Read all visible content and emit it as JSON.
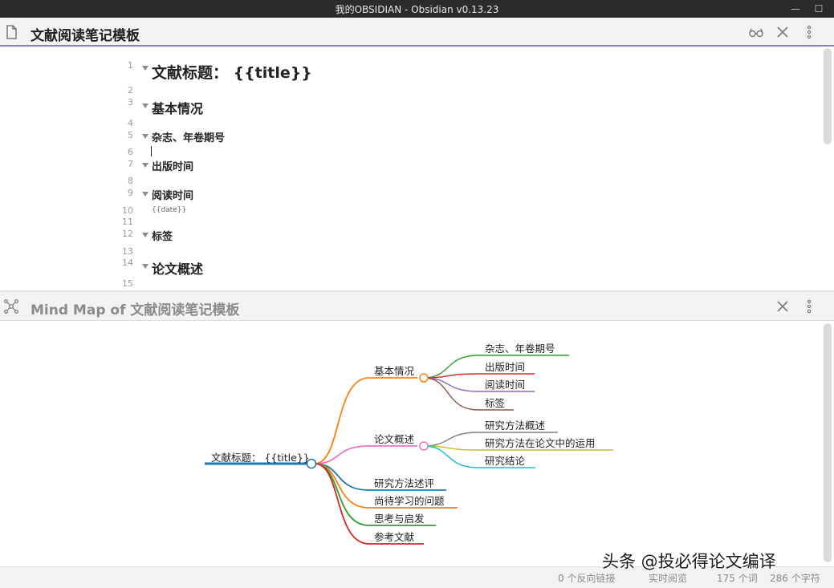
{
  "window": {
    "title": "我的OBSIDIAN - Obsidian v0.13.23",
    "minimize": "—",
    "maximize": "☐"
  },
  "editor": {
    "title": "文献阅读笔记模板",
    "icons": [
      "file-icon",
      "reading-view-icon",
      "close-icon",
      "more-options-icon"
    ],
    "lines": [
      {
        "n": "1",
        "text": "文献标题： {{title}}",
        "style": "h1",
        "fold": true
      },
      {
        "n": "2",
        "text": "",
        "style": "",
        "fold": false
      },
      {
        "n": "3",
        "text": "基本情况",
        "style": "h2",
        "fold": true
      },
      {
        "n": "4",
        "text": "",
        "style": "",
        "fold": false
      },
      {
        "n": "5",
        "text": "杂志、年卷期号",
        "style": "h3",
        "fold": true
      },
      {
        "n": "6",
        "text": "",
        "style": "",
        "fold": false
      },
      {
        "n": "7",
        "text": "出版时间",
        "style": "h3",
        "fold": true
      },
      {
        "n": "8",
        "text": "",
        "style": "",
        "fold": false
      },
      {
        "n": "9",
        "text": "阅读时间",
        "style": "h3",
        "fold": true
      },
      {
        "n": "10",
        "text": "{{date}}",
        "style": "small",
        "fold": false
      },
      {
        "n": "11",
        "text": "",
        "style": "",
        "fold": false
      },
      {
        "n": "12",
        "text": "标签",
        "style": "h3",
        "fold": true
      },
      {
        "n": "13",
        "text": "",
        "style": "",
        "fold": false
      },
      {
        "n": "14",
        "text": "论文概述",
        "style": "h2",
        "fold": true
      },
      {
        "n": "15",
        "text": "",
        "style": "",
        "fold": false
      }
    ]
  },
  "mindmap": {
    "title": "Mind Map of 文献阅读笔记模板",
    "root": {
      "label": "文献标题： {{title}}",
      "color": "#1f77b4"
    },
    "branches": [
      {
        "label": "基本情况",
        "color": "#ff7f0e",
        "collapsible": true,
        "children": [
          {
            "label": "杂志、年卷期号",
            "color": "#2ca02c"
          },
          {
            "label": "出版时间",
            "color": "#d62728"
          },
          {
            "label": "阅读时间",
            "color": "#9467bd"
          },
          {
            "label": "标签",
            "color": "#8c564b"
          }
        ]
      },
      {
        "label": "论文概述",
        "color": "#e377c2",
        "collapsible": true,
        "children": [
          {
            "label": "研究方法概述",
            "color": "#7f7f7f"
          },
          {
            "label": "研究方法在论文中的运用",
            "color": "#bcbd22"
          },
          {
            "label": "研究结论",
            "color": "#17becf"
          }
        ]
      },
      {
        "label": "研究方法述评",
        "color": "#1f77b4",
        "children": []
      },
      {
        "label": "尚待学习的问题",
        "color": "#ff7f0e",
        "children": []
      },
      {
        "label": "思考与启发",
        "color": "#2ca02c",
        "children": []
      },
      {
        "label": "参考文献",
        "color": "#d62728",
        "children": []
      }
    ]
  },
  "status": {
    "backlinks": "0 个反向链接",
    "mode": "实时阅览",
    "words": "175 个词",
    "chars": "286 个字符"
  },
  "watermark": "头条 @投必得论文编译"
}
